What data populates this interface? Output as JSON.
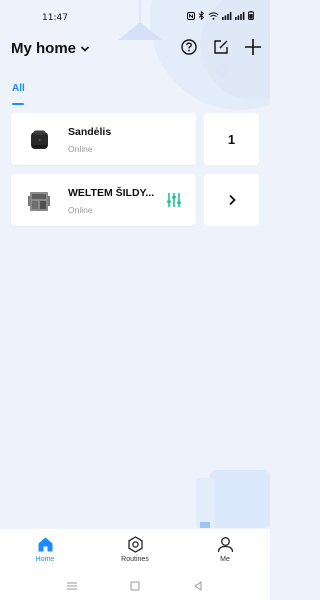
{
  "status_bar": {
    "time": "11:47",
    "icons": [
      "nfc-icon",
      "bluetooth-icon",
      "wifi-icon",
      "signal-icon",
      "signal-icon",
      "battery-icon"
    ]
  },
  "header": {
    "home_title": "My home",
    "actions": [
      "help-icon",
      "edit-icon",
      "add-icon"
    ]
  },
  "tabs": [
    {
      "label": "All",
      "active": true
    }
  ],
  "devices": [
    {
      "name": "Sandėlis",
      "status": "Online",
      "side": "1",
      "icon": "hub-device-icon"
    },
    {
      "name": "WELTEM ŠILDY...",
      "status": "Online",
      "side": "›",
      "icon": "controller-device-icon",
      "action_icon": "sliders-icon"
    }
  ],
  "bottom_nav": [
    {
      "label": "Home",
      "icon": "home-icon",
      "active": true
    },
    {
      "label": "Routines",
      "icon": "routines-icon",
      "active": false
    },
    {
      "label": "Me",
      "icon": "profile-icon",
      "active": false
    }
  ],
  "colors": {
    "accent": "#1a8cff",
    "background": "#eef3fb",
    "card": "#ffffff",
    "action": "#19c39a"
  }
}
